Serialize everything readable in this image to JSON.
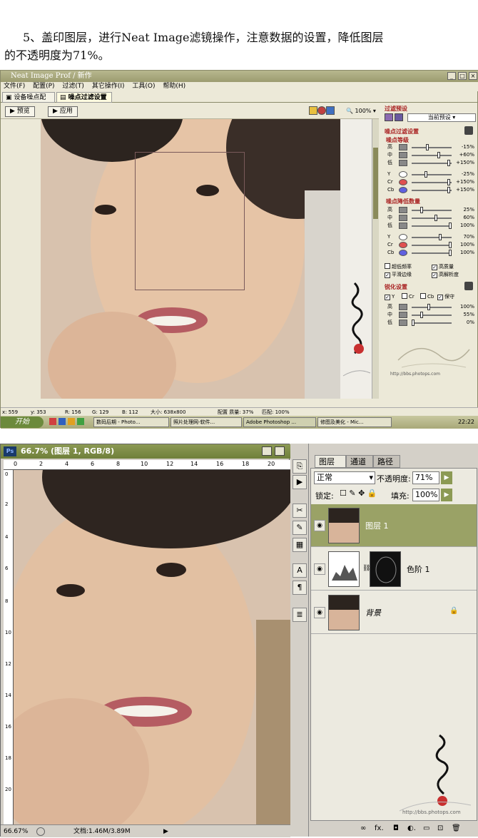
{
  "caption": {
    "line1": "5、盖印图层，进行Neat Image滤镜操作，注意数据的设置，降低图层",
    "line2": "的不透明度为71%。"
  },
  "neat_image": {
    "title": "Neat Image Prof / 新作",
    "menu": [
      "文件(F)",
      "配置(P)",
      "过滤(T)",
      "其它操作(I)",
      "工具(O)",
      "帮助(H)"
    ],
    "tabs": [
      "设备噪点配置",
      "噪点过滤设置"
    ],
    "preview_button": "预览",
    "apply_button": "应用",
    "zoom": "100%",
    "panel": {
      "preset_header": "过滤预设",
      "preset_value": "当前预设",
      "filter_header": "噪点过滤设置",
      "level_header": "噪点等级",
      "levels": [
        {
          "name": "高",
          "value": "-15%"
        },
        {
          "name": "中",
          "value": "+60%"
        },
        {
          "name": "低",
          "value": "+150%"
        },
        {
          "name": "Y",
          "value": "-25%"
        },
        {
          "name": "Cr",
          "value": "+150%"
        },
        {
          "name": "Cb",
          "value": "+150%"
        }
      ],
      "reduce_header": "噪点降低数量",
      "reduce": [
        {
          "name": "高",
          "value": "25%"
        },
        {
          "name": "中",
          "value": "60%"
        },
        {
          "name": "低",
          "value": "100%"
        },
        {
          "name": "Y",
          "value": "70%"
        },
        {
          "name": "Cr",
          "value": "100%"
        },
        {
          "name": "Cb",
          "value": "100%"
        }
      ],
      "options": [
        "超低频率",
        "高质量",
        "平滑边缘",
        "高解析度"
      ],
      "sharpen_header": "锐化设置",
      "sharpen_channels": [
        "Y",
        "Cr",
        "Cb",
        "保守"
      ],
      "sharpen": [
        {
          "name": "高",
          "value": "100%"
        },
        {
          "name": "中",
          "value": "55%"
        },
        {
          "name": "低",
          "value": "0%"
        }
      ],
      "url": "http://bbs.photops.com"
    },
    "status": {
      "x": "x: 559",
      "y": "y: 353",
      "r": "R: 156",
      "g": "G: 129",
      "b": "B: 112",
      "size": "大小: 638x800",
      "quality": "配置 质量: 37%",
      "match": "匹配: 100%"
    },
    "taskbar": {
      "start": "开始",
      "tasks": [
        "数码后期 - Photo...",
        "照片处理网-软件...",
        "Adobe Photoshop ...",
        "修图及美化 - Mic..."
      ],
      "time": "22:22"
    }
  },
  "photoshop": {
    "doc_title": "66.7% (图层 1, RGB/8)",
    "ruler_h": [
      "0",
      "2",
      "4",
      "6",
      "8",
      "10",
      "12",
      "14",
      "16",
      "18",
      "20"
    ],
    "ruler_v": [
      "0",
      "2",
      "4",
      "6",
      "8",
      "10",
      "12",
      "14",
      "16",
      "18",
      "20"
    ],
    "zoom": "66.67%",
    "doc_size": "文档:1.46M/3.89M",
    "layers_tabs": [
      "图层",
      "通道",
      "路径"
    ],
    "blend_mode": "正常",
    "opacity_label": "不透明度:",
    "opacity": "71%",
    "lock_label": "锁定:",
    "fill_label": "填充:",
    "fill": "100%",
    "layers": [
      {
        "name": "图层 1",
        "selected": true
      },
      {
        "name": "色阶 1",
        "selected": false
      },
      {
        "name": "背景",
        "selected": false
      }
    ],
    "url": "http://bbs.photops.com"
  }
}
